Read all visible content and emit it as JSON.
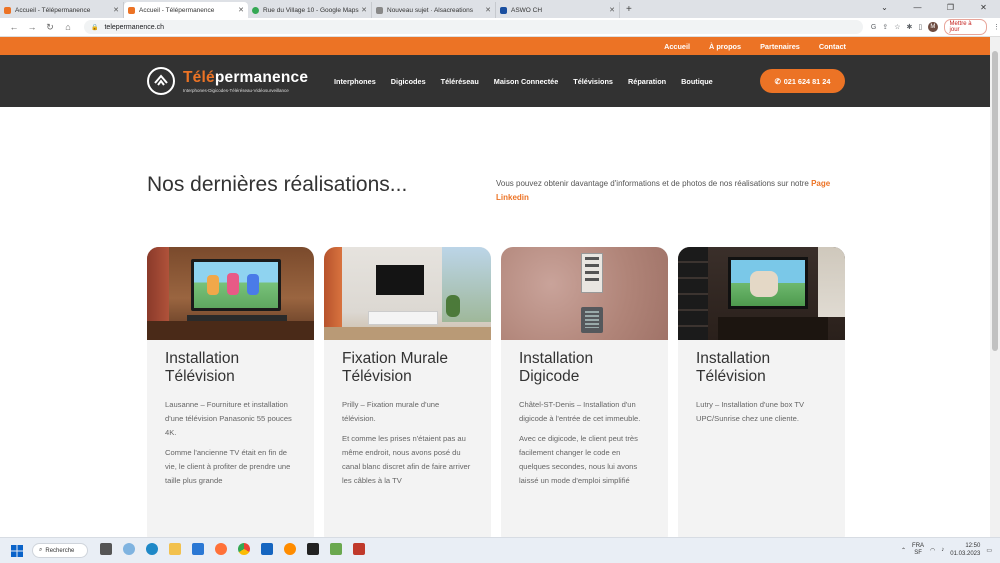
{
  "browser": {
    "tabs": [
      {
        "title": "Accueil - Télépermanence",
        "icon_color": "#ec7325",
        "active": false
      },
      {
        "title": "Accueil - Télépermanence",
        "icon_color": "#ec7325",
        "active": true
      },
      {
        "title": "Rue du Village 10 - Google Maps",
        "icon_color": "#34a853",
        "active": false
      },
      {
        "title": "Nouveau sujet · Alsacreations",
        "icon_color": "#888888",
        "active": false
      },
      {
        "title": "ASWO CH",
        "icon_color": "#1a4fa0",
        "active": false
      }
    ],
    "new_tab": "+",
    "url": "telepermanence.ch",
    "update_label": "Mettre à jour",
    "avatar_letter": "M"
  },
  "site": {
    "top_links": [
      "Accueil",
      "À propos",
      "Partenaires",
      "Contact"
    ],
    "logo": {
      "prefix": "Télé",
      "suffix": "permanence",
      "tagline": "Interphones-Digicodes-Téléréseau-Vidéosurveillance"
    },
    "menu": [
      "Interphones",
      "Digicodes",
      "Téléréseau",
      "Maison Connectée",
      "Télévisions",
      "Réparation",
      "Boutique"
    ],
    "phone": "021 624 81 24",
    "accent": "#ec7325"
  },
  "section": {
    "title_start": "Nos dernières ",
    "title_highlight": "réalisations...",
    "intro": "Vous pouvez obtenir davantage d'informations et de photos de nos réalisations sur notre ",
    "intro_link": "Page Linkedin"
  },
  "cards": [
    {
      "title": "Installation Télévision",
      "p1": "Lausanne – Fourniture et installation d'une télévision Panasonic 55 pouces 4K.",
      "p2": "Comme l'ancienne TV était en fin de vie, le client à profiter de prendre une taille plus grande"
    },
    {
      "title": "Fixation Murale Télévision",
      "p1": "Prilly – Fixation murale d'une télévision.",
      "p2": "Et comme les prises n'étaient pas au même endroit, nous avons posé du canal blanc discret afin de faire arriver les câbles à la TV"
    },
    {
      "title": "Installation Digicode",
      "p1": "Châtel-ST-Denis – Installation d'un digicode à l'entrée de cet immeuble.",
      "p2": "Avec ce digicode, le client peut très facilement changer le code en quelques secondes, nous lui avons laissé un mode d'emploi simplifié"
    },
    {
      "title": "Installation Télévision",
      "p1": "Lutry – Installation d'une box TV UPC/Sunrise chez une cliente.",
      "p2": ""
    }
  ],
  "taskbar": {
    "search_label": "Recherche",
    "lang": "FRA",
    "lang2": "SF",
    "time": "12:50",
    "date": "01.03.2023"
  }
}
